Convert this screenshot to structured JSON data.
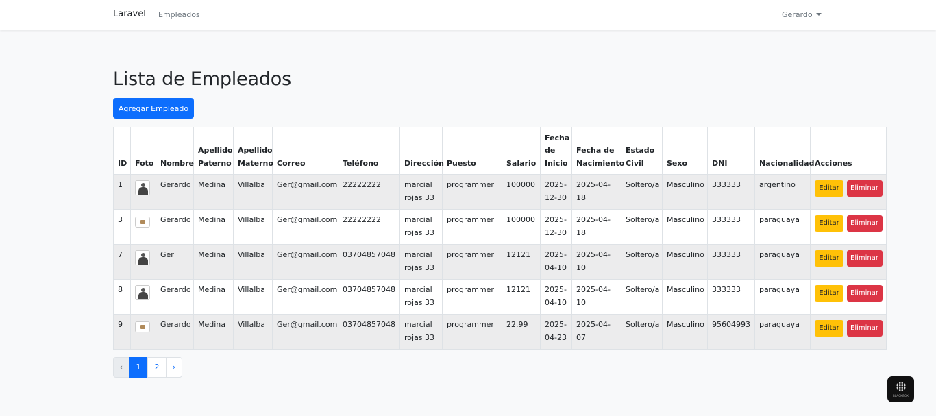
{
  "navbar": {
    "brand": "Laravel",
    "link": "Empleados",
    "user": "Gerardo"
  },
  "main": {
    "title": "Lista de Empleados",
    "add_button": "Agregar Empleado"
  },
  "table": {
    "headers": [
      "ID",
      "Foto",
      "Nombre",
      "Apellido Paterno",
      "Apellido Materno",
      "Correo",
      "Teléfono",
      "Dirección",
      "Puesto",
      "Salario",
      "Fecha de Inicio",
      "Fecha de Nacimiento",
      "Estado Civil",
      "Sexo",
      "DNI",
      "Nacionalidad",
      "Acciones"
    ],
    "rows": [
      {
        "id": "1",
        "foto": "person-photo",
        "nombre": "Gerardo",
        "apellido_paterno": "Medina",
        "apellido_materno": "Villalba",
        "correo": "Ger@gmail.com",
        "telefono": "22222222",
        "direccion": "marcial rojas 33",
        "puesto": "programmer",
        "salario": "100000",
        "fecha_inicio": "2025-12-30",
        "fecha_nacimiento": "2025-04-18",
        "estado_civil": "Soltero/a",
        "sexo": "Masculino",
        "dni": "333333",
        "nacionalidad": "argentino"
      },
      {
        "id": "3",
        "foto": "small-photo",
        "nombre": "Gerardo",
        "apellido_paterno": "Medina",
        "apellido_materno": "Villalba",
        "correo": "Ger@gmail.com",
        "telefono": "22222222",
        "direccion": "marcial rojas 33",
        "puesto": "programmer",
        "salario": "100000",
        "fecha_inicio": "2025-12-30",
        "fecha_nacimiento": "2025-04-18",
        "estado_civil": "Soltero/a",
        "sexo": "Masculino",
        "dni": "333333",
        "nacionalidad": "paraguaya"
      },
      {
        "id": "7",
        "foto": "person-photo",
        "nombre": "Ger",
        "apellido_paterno": "Medina",
        "apellido_materno": "Villalba",
        "correo": "Ger@gmail.com",
        "telefono": "03704857048",
        "direccion": "marcial rojas 33",
        "puesto": "programmer",
        "salario": "12121",
        "fecha_inicio": "2025-04-10",
        "fecha_nacimiento": "2025-04-10",
        "estado_civil": "Soltero/a",
        "sexo": "Masculino",
        "dni": "333333",
        "nacionalidad": "paraguaya"
      },
      {
        "id": "8",
        "foto": "person-photo",
        "nombre": "Gerardo",
        "apellido_paterno": "Medina",
        "apellido_materno": "Villalba",
        "correo": "Ger@gmail.com",
        "telefono": "03704857048",
        "direccion": "marcial rojas 33",
        "puesto": "programmer",
        "salario": "12121",
        "fecha_inicio": "2025-04-10",
        "fecha_nacimiento": "2025-04-10",
        "estado_civil": "Soltero/a",
        "sexo": "Masculino",
        "dni": "333333",
        "nacionalidad": "paraguaya"
      },
      {
        "id": "9",
        "foto": "small-photo",
        "nombre": "Gerardo",
        "apellido_paterno": "Medina",
        "apellido_materno": "Villalba",
        "correo": "Ger@gmail.com",
        "telefono": "03704857048",
        "direccion": "marcial rojas 33",
        "puesto": "programmer",
        "salario": "22.99",
        "fecha_inicio": "2025-04-23",
        "fecha_nacimiento": "2025-04-07",
        "estado_civil": "Soltero/a",
        "sexo": "Masculino",
        "dni": "95604993",
        "nacionalidad": "paraguaya"
      }
    ],
    "edit_label": "Editar",
    "delete_label": "Eliminar"
  },
  "pagination": {
    "prev": "‹",
    "pages": [
      "1",
      "2"
    ],
    "active_page": "1",
    "next": "›"
  },
  "widget": {
    "label": "BLACKBOX"
  },
  "colors": {
    "primary": "#0d6efd",
    "warning": "#ffc107",
    "danger": "#dc3545"
  }
}
